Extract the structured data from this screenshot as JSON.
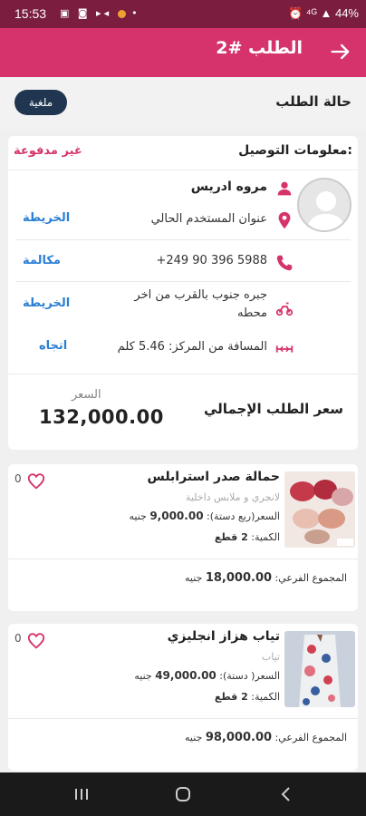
{
  "status_bar": {
    "time": "15:53",
    "icons_text": "▣ ◙ ▸◂",
    "battery": "44%"
  },
  "app_bar": {
    "title": "الطلب #2"
  },
  "order_status": {
    "label": "حالة الطلب",
    "badge": "ملغية"
  },
  "delivery": {
    "title": "معلومات التوصيل:",
    "payment_status": "غير مدفوعة",
    "customer_name": "مروه ادريس",
    "address_label": "عنوان المستخدم الحالي",
    "map_link_1": "الخريطة",
    "phone": "+249 90 396 5988",
    "call_link": "مكالمة",
    "landmark_line1": "جبره جنوب بالقرب من اخر",
    "landmark_line2": "محطه",
    "map_link_2": "الخريطة",
    "distance": "المسافة من المركز: 5.46 كلم",
    "direction_link": "اتجاه"
  },
  "totals": {
    "label": "سعر الطلب الإجمالي",
    "price_caption": "السعر",
    "price_value": "132,000.00"
  },
  "products": [
    {
      "name": "حمالة صدر استرابلس",
      "category": "لانجري و ملابس داخلية",
      "price_label": "السعر(ربع دستة):",
      "price_value": "9,000.00",
      "currency": "جنيه",
      "qty_label": "الكمية:",
      "qty_value": "2 قطع",
      "fav_count": "0",
      "subtotal_label": "المجموع الفرعي:",
      "subtotal_value": "18,000.00",
      "subtotal_currency": "جنيه"
    },
    {
      "name": "تياب هزاز انجليزي",
      "category": "تياب",
      "price_label": "السعر( دستة):",
      "price_value": "49,000.00",
      "currency": "جنيه",
      "qty_label": "الكمية:",
      "qty_value": "2 قطع",
      "fav_count": "0",
      "subtotal_label": "المجموع الفرعي:",
      "subtotal_value": "98,000.00",
      "subtotal_currency": "جنيه"
    }
  ],
  "colors": {
    "primary": "#d6336c",
    "status_bar": "#7a1d3f",
    "badge": "#203650",
    "link": "#2a7fd4"
  }
}
